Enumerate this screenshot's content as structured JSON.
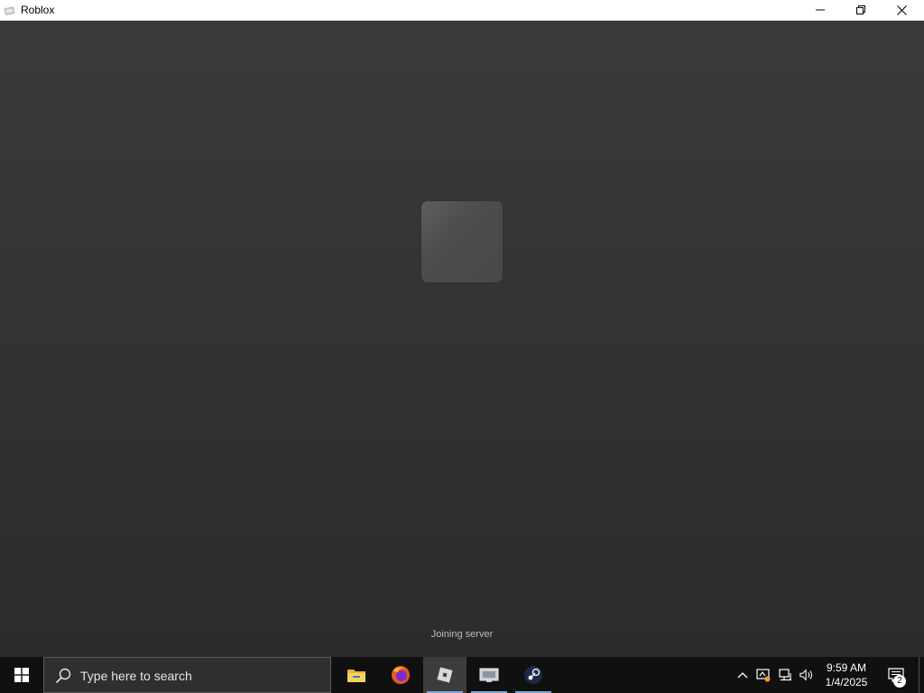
{
  "window": {
    "title": "Roblox",
    "app_icon": "roblox-icon",
    "controls": [
      "minimize-icon",
      "restore-icon",
      "close-icon"
    ]
  },
  "game": {
    "status": "Joining server"
  },
  "taskbar": {
    "search_placeholder": "Type here to search",
    "apps": [
      {
        "name": "file-explorer-icon"
      },
      {
        "name": "firefox-icon"
      },
      {
        "name": "roblox-icon",
        "active": true
      },
      {
        "name": "roblox-studio-icon"
      },
      {
        "name": "steam-icon"
      }
    ],
    "tray_icons": [
      "chevron-up-icon",
      "defender-icon",
      "network-icon",
      "volume-icon"
    ],
    "clock": {
      "time": "9:59 AM",
      "date": "1/4/2025"
    },
    "notifications_count": "2"
  },
  "colors": {
    "background_top": "#3a3a3a",
    "background_bottom": "#2c2c2c",
    "taskbar": "#101010",
    "active_indicator": "#7aa8d8"
  }
}
